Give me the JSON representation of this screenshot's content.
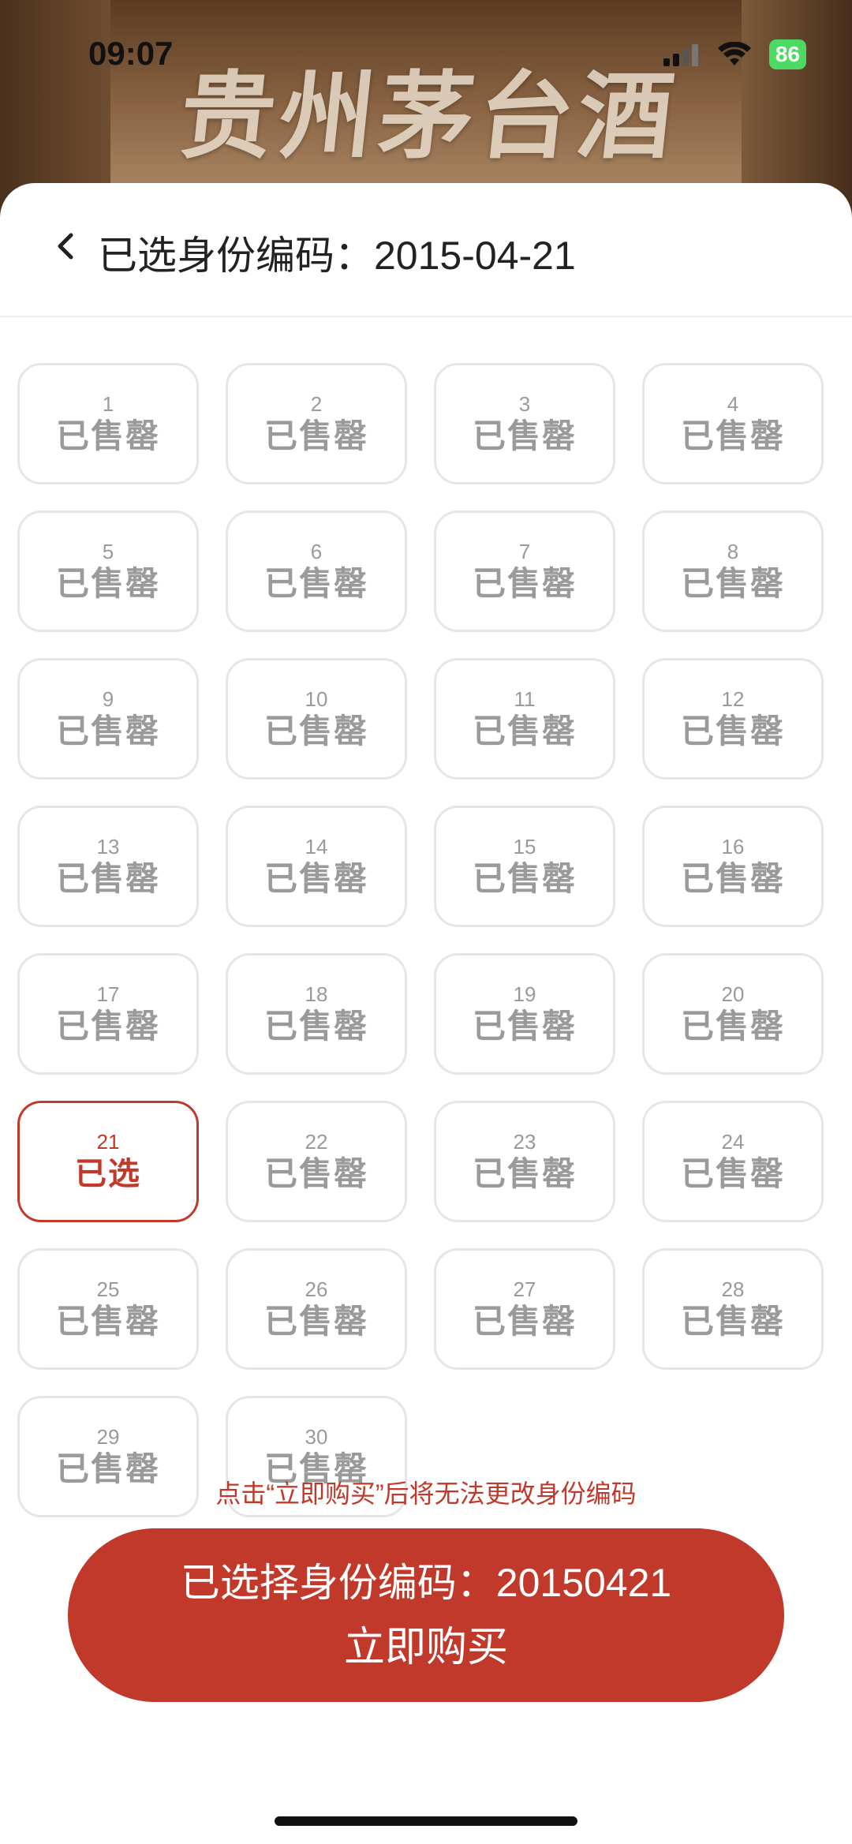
{
  "status": {
    "time": "09:07",
    "battery": "86"
  },
  "banner": {
    "brand_text": "贵州茅台酒"
  },
  "header": {
    "title": "已选身份编码：2015-04-21"
  },
  "grid": [
    {
      "num": "1",
      "status": "已售罄"
    },
    {
      "num": "2",
      "status": "已售罄"
    },
    {
      "num": "3",
      "status": "已售罄"
    },
    {
      "num": "4",
      "status": "已售罄"
    },
    {
      "num": "5",
      "status": "已售罄"
    },
    {
      "num": "6",
      "status": "已售罄"
    },
    {
      "num": "7",
      "status": "已售罄"
    },
    {
      "num": "8",
      "status": "已售罄"
    },
    {
      "num": "9",
      "status": "已售罄"
    },
    {
      "num": "10",
      "status": "已售罄"
    },
    {
      "num": "11",
      "status": "已售罄"
    },
    {
      "num": "12",
      "status": "已售罄"
    },
    {
      "num": "13",
      "status": "已售罄"
    },
    {
      "num": "14",
      "status": "已售罄"
    },
    {
      "num": "15",
      "status": "已售罄"
    },
    {
      "num": "16",
      "status": "已售罄"
    },
    {
      "num": "17",
      "status": "已售罄"
    },
    {
      "num": "18",
      "status": "已售罄"
    },
    {
      "num": "19",
      "status": "已售罄"
    },
    {
      "num": "20",
      "status": "已售罄"
    },
    {
      "num": "21",
      "status": "已选",
      "selected": true
    },
    {
      "num": "22",
      "status": "已售罄"
    },
    {
      "num": "23",
      "status": "已售罄"
    },
    {
      "num": "24",
      "status": "已售罄"
    },
    {
      "num": "25",
      "status": "已售罄"
    },
    {
      "num": "26",
      "status": "已售罄"
    },
    {
      "num": "27",
      "status": "已售罄"
    },
    {
      "num": "28",
      "status": "已售罄"
    },
    {
      "num": "29",
      "status": "已售罄"
    },
    {
      "num": "30",
      "status": "已售罄"
    }
  ],
  "notice": "点击“立即购买”后将无法更改身份编码",
  "buy_button": {
    "line1": "已选择身份编码：20150421",
    "line2": "立即购买"
  },
  "colors": {
    "accent": "#c0392b",
    "muted": "#9a9a9a",
    "border": "#e6e6e6"
  }
}
